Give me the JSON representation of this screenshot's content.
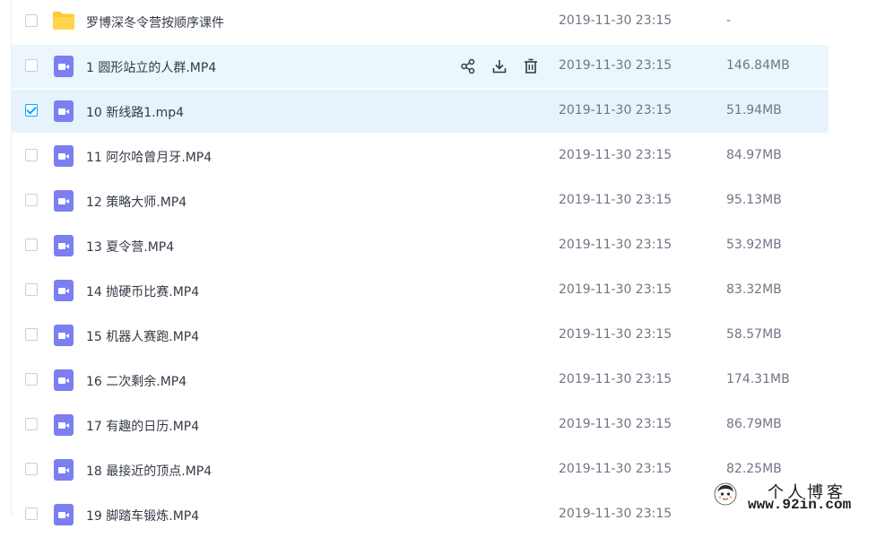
{
  "files": [
    {
      "name": "罗博深冬令营按顺序课件",
      "time": "2019-11-30 23:15",
      "size": "-",
      "type": "folder",
      "checked": false,
      "state": "normal"
    },
    {
      "name": "1 圆形站立的人群.MP4",
      "time": "2019-11-30 23:15",
      "size": "146.84MB",
      "type": "video",
      "checked": false,
      "state": "hover"
    },
    {
      "name": "10 新线路1.mp4",
      "time": "2019-11-30 23:15",
      "size": "51.94MB",
      "type": "video",
      "checked": true,
      "state": "selected"
    },
    {
      "name": "11 阿尔哈曾月牙.MP4",
      "time": "2019-11-30 23:15",
      "size": "84.97MB",
      "type": "video",
      "checked": false,
      "state": "normal"
    },
    {
      "name": "12 策略大师.MP4",
      "time": "2019-11-30 23:15",
      "size": "95.13MB",
      "type": "video",
      "checked": false,
      "state": "normal"
    },
    {
      "name": "13 夏令营.MP4",
      "time": "2019-11-30 23:15",
      "size": "53.92MB",
      "type": "video",
      "checked": false,
      "state": "normal"
    },
    {
      "name": "14 抛硬币比赛.MP4",
      "time": "2019-11-30 23:15",
      "size": "83.32MB",
      "type": "video",
      "checked": false,
      "state": "normal"
    },
    {
      "name": "15 机器人赛跑.MP4",
      "time": "2019-11-30 23:15",
      "size": "58.57MB",
      "type": "video",
      "checked": false,
      "state": "normal"
    },
    {
      "name": "16 二次剩余.MP4",
      "time": "2019-11-30 23:15",
      "size": "174.31MB",
      "type": "video",
      "checked": false,
      "state": "normal"
    },
    {
      "name": "17 有趣的日历.MP4",
      "time": "2019-11-30 23:15",
      "size": "86.79MB",
      "type": "video",
      "checked": false,
      "state": "normal"
    },
    {
      "name": "18 最接近的顶点.MP4",
      "time": "2019-11-30 23:15",
      "size": "82.25MB",
      "type": "video",
      "checked": false,
      "state": "normal"
    },
    {
      "name": "19 脚踏车锻炼.MP4",
      "time": "2019-11-30 23:15",
      "size": "",
      "type": "video",
      "checked": false,
      "state": "normal"
    }
  ],
  "row_actions": [
    {
      "icon": "share-icon"
    },
    {
      "icon": "download-icon"
    },
    {
      "icon": "trash-icon"
    }
  ],
  "watermark": {
    "title": "个人博客",
    "url": "www.92in.com"
  },
  "colors": {
    "accent": "#06a7ff",
    "folder": "#fcc934",
    "video": "#7b7ff0",
    "hover_row": "#ebf6fd",
    "selected_row": "#e6f3fd",
    "name_text": "#333a45",
    "meta_text": "#6f7685"
  }
}
